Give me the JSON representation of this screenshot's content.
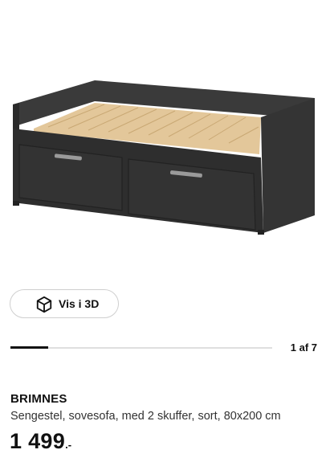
{
  "product": {
    "name": "BRIMNES",
    "description": "Sengestel, sovesofa, med 2 skuffer, sort, 80x200 cm",
    "price_amount": "1 499",
    "price_suffix": ".-"
  },
  "view3d": {
    "label": "Vis i 3D",
    "icon": "cube-icon"
  },
  "gallery": {
    "counter": "1 af 7",
    "progress_fraction": 0.143
  },
  "colors": {
    "frame": "#2e2e2e",
    "slats": "#e3c79a",
    "text": "#111111",
    "border": "#cfcfcf"
  }
}
